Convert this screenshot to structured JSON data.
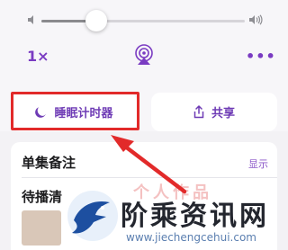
{
  "player": {
    "speed_label": "1×",
    "more_label": "•••",
    "volume_level": 0.27
  },
  "buttons": {
    "sleep_timer_label": "睡眠计时器",
    "share_label": "共享"
  },
  "sheet": {
    "notes_title": "单集备注",
    "notes_show": "显示",
    "queue_title": "待播清",
    "ghost_text": "个人作品"
  },
  "watermark": {
    "brand": "阶乘资讯网",
    "url": "www.jiechengcehui.com"
  },
  "colors": {
    "accent": "#7a3bc2",
    "highlight": "#e22a2a",
    "background": "#f3f2f5"
  },
  "icons": {
    "volume_low": "speaker-low-icon",
    "volume_high": "speaker-high-icon",
    "airplay": "airplay-icon",
    "sleep": "moon-icon",
    "share": "share-icon"
  }
}
